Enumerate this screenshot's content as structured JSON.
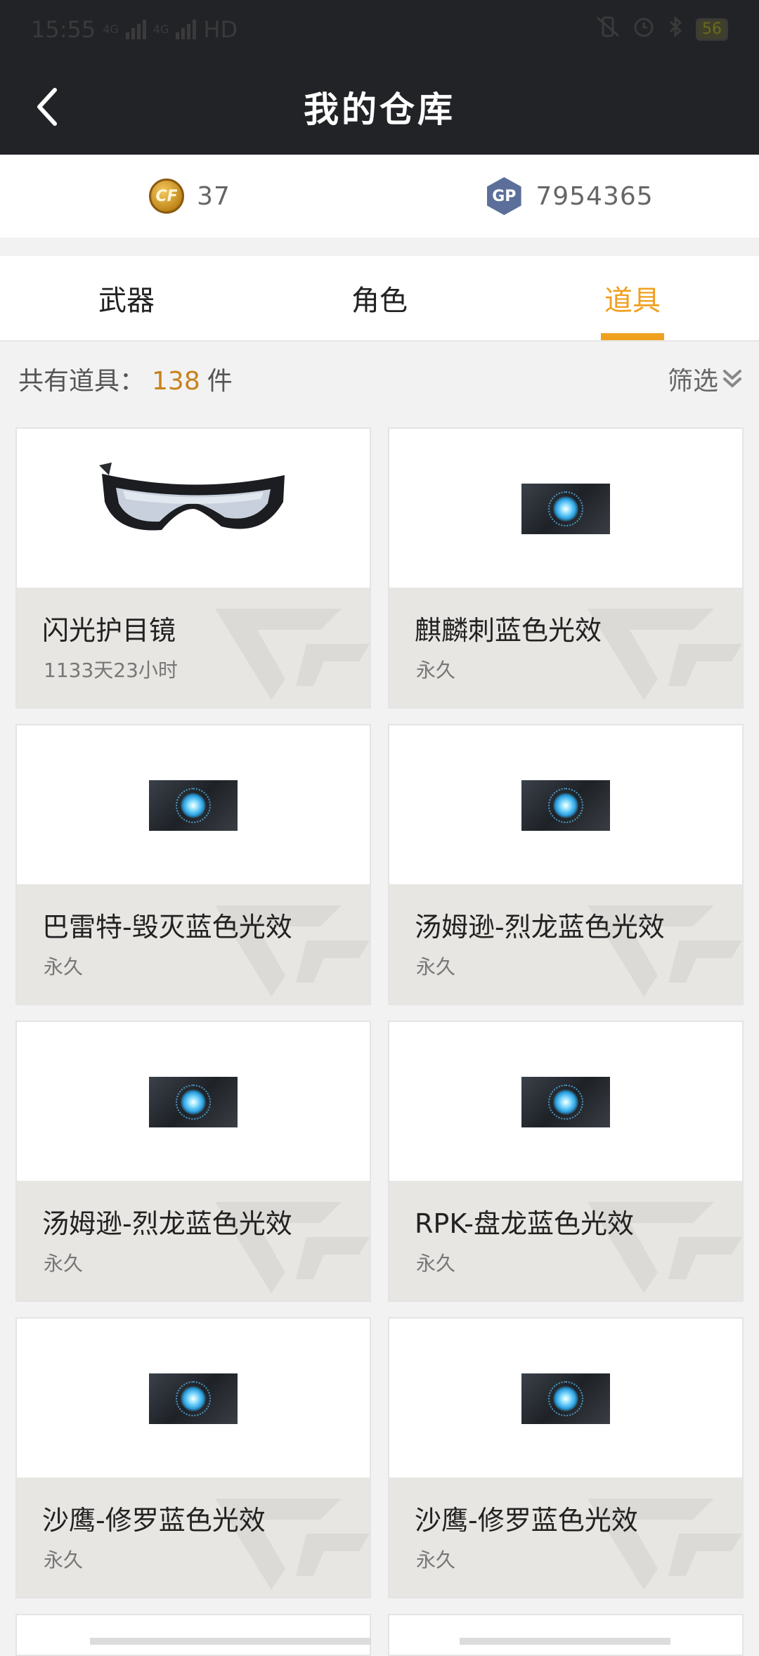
{
  "status_bar": {
    "time": "15:55",
    "net1": "4G",
    "net2": "4G",
    "hd": "HD",
    "battery": "56"
  },
  "header": {
    "title": "我的仓库"
  },
  "currency": {
    "cf_points": "37",
    "gp_label": "GP",
    "gp_points": "7954365"
  },
  "tabs": [
    {
      "label": "武器",
      "active": false
    },
    {
      "label": "角色",
      "active": false
    },
    {
      "label": "道具",
      "active": true
    }
  ],
  "summary": {
    "prefix": "共有道具：",
    "count": "138",
    "unit": "件",
    "filter_label": "筛选"
  },
  "items": [
    {
      "name": "闪光护目镜",
      "duration": "1133天23小时",
      "image": "goggles-image"
    },
    {
      "name": "麒麟刺蓝色光效",
      "duration": "永久",
      "image": "blue-effect-image"
    },
    {
      "name": "巴雷特-毁灭蓝色光效",
      "duration": "永久",
      "image": "blue-effect-image"
    },
    {
      "name": "汤姆逊-烈龙蓝色光效",
      "duration": "永久",
      "image": "blue-effect-image"
    },
    {
      "name": "汤姆逊-烈龙蓝色光效",
      "duration": "永久",
      "image": "blue-effect-image"
    },
    {
      "name": "RPK-盘龙蓝色光效",
      "duration": "永久",
      "image": "blue-effect-image"
    },
    {
      "name": "沙鹰-修罗蓝色光效",
      "duration": "永久",
      "image": "blue-effect-image"
    },
    {
      "name": "沙鹰-修罗蓝色光效",
      "duration": "永久",
      "image": "blue-effect-image"
    }
  ],
  "colors": {
    "accent": "#f0a020",
    "header_bg": "#222327",
    "card_info_bg": "#e8e6e3"
  }
}
